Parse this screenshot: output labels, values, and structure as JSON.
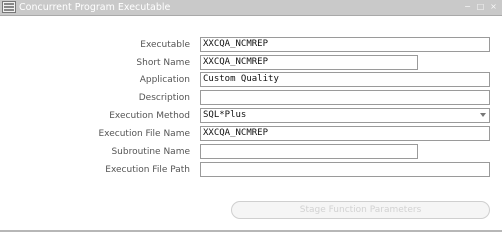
{
  "window": {
    "title": "Concurrent Program Executable",
    "icon": "oracle-forms-icon",
    "controls": [
      "minimize",
      "maximize",
      "close"
    ]
  },
  "fields": {
    "executable": {
      "label": "Executable",
      "value": "XXCQA_NCMREP"
    },
    "short_name": {
      "label": "Short Name",
      "value": "XXCQA_NCMREP"
    },
    "application": {
      "label": "Application",
      "value": "Custom Quality"
    },
    "description": {
      "label": "Description",
      "value": ""
    },
    "execution_method": {
      "label": "Execution Method",
      "value": "SQL*Plus"
    },
    "execution_file_name": {
      "label": "Execution File Name",
      "value": "XXCQA_NCMREP"
    },
    "subroutine_name": {
      "label": "Subroutine Name",
      "value": ""
    },
    "execution_file_path": {
      "label": "Execution File Path",
      "value": ""
    }
  },
  "buttons": {
    "stage_function_parameters": "Stage Function Parameters"
  }
}
